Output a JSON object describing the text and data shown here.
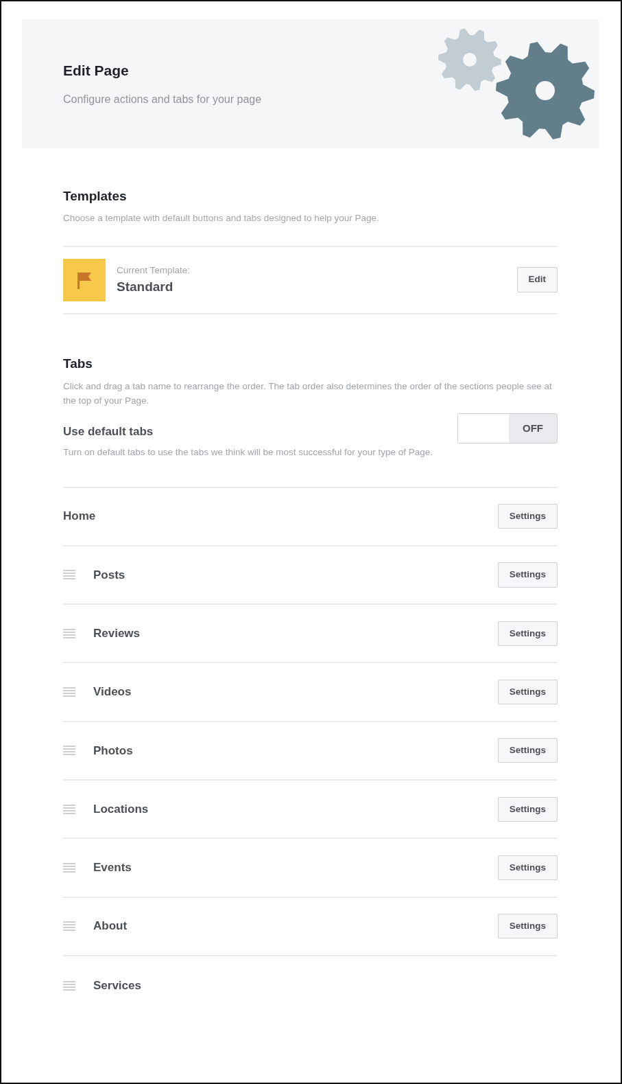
{
  "header": {
    "title": "Edit Page",
    "subtitle": "Configure actions and tabs for your page"
  },
  "templates": {
    "title": "Templates",
    "description": "Choose a template with default buttons and tabs designed to help your Page.",
    "current_label": "Current Template:",
    "current_name": "Standard",
    "edit_button": "Edit"
  },
  "tabs_section": {
    "title": "Tabs",
    "description": "Click and drag a tab name to rearrange the order. The tab order also determines the order of the sections people see at the top of your Page.",
    "default_tabs": {
      "label": "Use default tabs",
      "description": "Turn on default tabs to use the tabs we think will be most successful for your type of Page.",
      "on": false,
      "toggle_label": "OFF"
    }
  },
  "tab_rows": [
    {
      "name": "Home",
      "kind": "fixed",
      "button": "Settings"
    },
    {
      "name": "Posts",
      "kind": "draggable",
      "button": "Settings"
    },
    {
      "name": "Reviews",
      "kind": "draggable",
      "button": "Settings"
    },
    {
      "name": "Videos",
      "kind": "draggable",
      "button": "Settings"
    },
    {
      "name": "Photos",
      "kind": "draggable",
      "button": "Settings"
    },
    {
      "name": "Locations",
      "kind": "draggable",
      "button": "Settings"
    },
    {
      "name": "Events",
      "kind": "draggable",
      "button": "Settings"
    },
    {
      "name": "About",
      "kind": "draggable",
      "button": "Settings"
    },
    {
      "name": "Services",
      "kind": "draggable"
    }
  ]
}
